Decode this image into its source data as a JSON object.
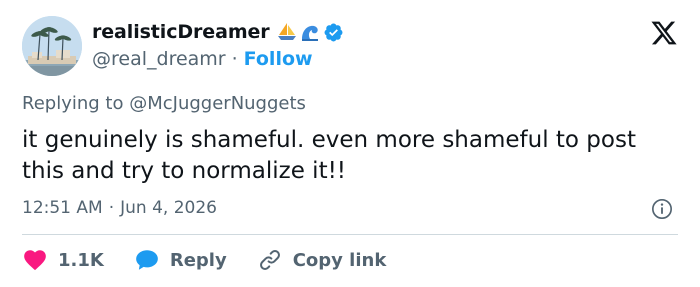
{
  "user": {
    "display_name": "realisticDreamer",
    "handle": "@real_dreamr",
    "separator": "·",
    "follow_label": "Follow",
    "emojis": [
      "sailboat-emoji",
      "wave-emoji"
    ],
    "verified": true
  },
  "reply_to": {
    "prefix": "Replying to",
    "mention": "@McJuggerNuggets"
  },
  "tweet": {
    "text": "it genuinely is shameful. even more shameful to post this and try to normalize it!!"
  },
  "meta": {
    "time": "12:51 AM",
    "separator": "·",
    "date": "Jun 4, 2026"
  },
  "actions": {
    "like_count": "1.1K",
    "reply_label": "Reply",
    "copy_label": "Copy link"
  },
  "colors": {
    "accent": "#1d9bf0",
    "like": "#f91880",
    "text_primary": "#0f1419",
    "text_secondary": "#536471",
    "divider": "#cfd9de"
  },
  "icons": {
    "brand": "x-logo-icon",
    "verified": "verified-badge-icon",
    "info": "info-icon",
    "like": "heart-icon",
    "reply": "speech-bubble-icon",
    "copy": "link-icon"
  }
}
